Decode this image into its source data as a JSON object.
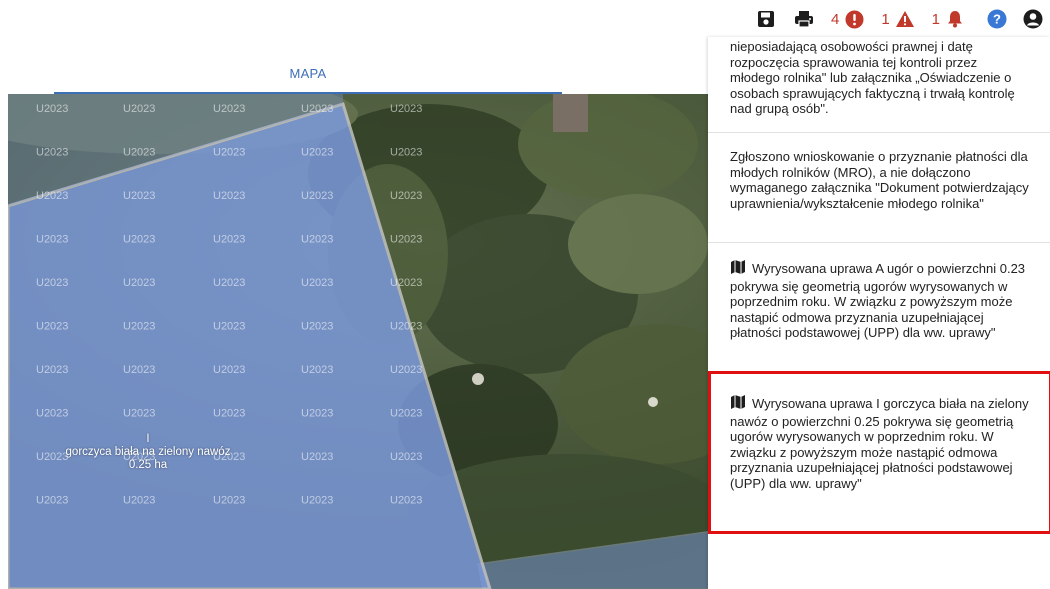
{
  "toolbar": {
    "save_icon": "floppy-disk-icon",
    "print_icon": "printer-icon",
    "error_count": "4",
    "error_icon": "exclamation-circle-icon",
    "warning_count": "1",
    "warning_icon": "warning-triangle-icon",
    "notification_count": "1",
    "notification_icon": "bell-icon",
    "help_icon": "question-circle-icon",
    "user_icon": "user-circle-icon",
    "colors": {
      "dark": "#1d1d1d",
      "error": "#c0392b",
      "help": "#3a78d6"
    }
  },
  "tab": {
    "label": "MAPA",
    "accent": "#3d6fb6"
  },
  "map": {
    "parcel_code": "U2023",
    "feature_label_id": "I",
    "feature_label_name": "gorczyca biała na zielony nawóz",
    "feature_label_area": "0.25 ha",
    "parcel_fill": "#7d9be0"
  },
  "messages": [
    {
      "icon": "",
      "text": "nieposiadającą osobowości prawnej i datę rozpoczęcia sprawowania tej kontroli przez młodego rolnika\" lub załącznika „Oświadczenie o osobach sprawujących faktyczną i trwałą kontrolę nad grupą osób\"."
    },
    {
      "icon": "",
      "text": "Zgłoszono wnioskowanie o przyznanie płatności dla młodych rolników (MRO), a nie dołączono wymaganego załącznika \"Dokument potwierdzający uprawnienia/wykształcenie młodego rolnika\""
    },
    {
      "icon": "map-icon",
      "text": "Wyrysowana uprawa A ugór o powierzchni 0.23 pokrywa się geometrią ugorów wyrysowanych w poprzednim roku. W związku z powyższym może nastąpić odmowa przyznania uzupełniającej płatności podstawowej (UPP) dla ww. uprawy\""
    },
    {
      "icon": "map-icon",
      "text": "Wyrysowana uprawa I gorczyca biała na zielony nawóz o powierzchni 0.25 pokrywa się geometrią ugorów wyrysowanych w poprzednim roku. W związku z powyższym może nastąpić odmowa przyznania uzupełniającej płatności podstawowej (UPP) dla ww. uprawy\""
    }
  ],
  "highlight_color": "#e01010"
}
